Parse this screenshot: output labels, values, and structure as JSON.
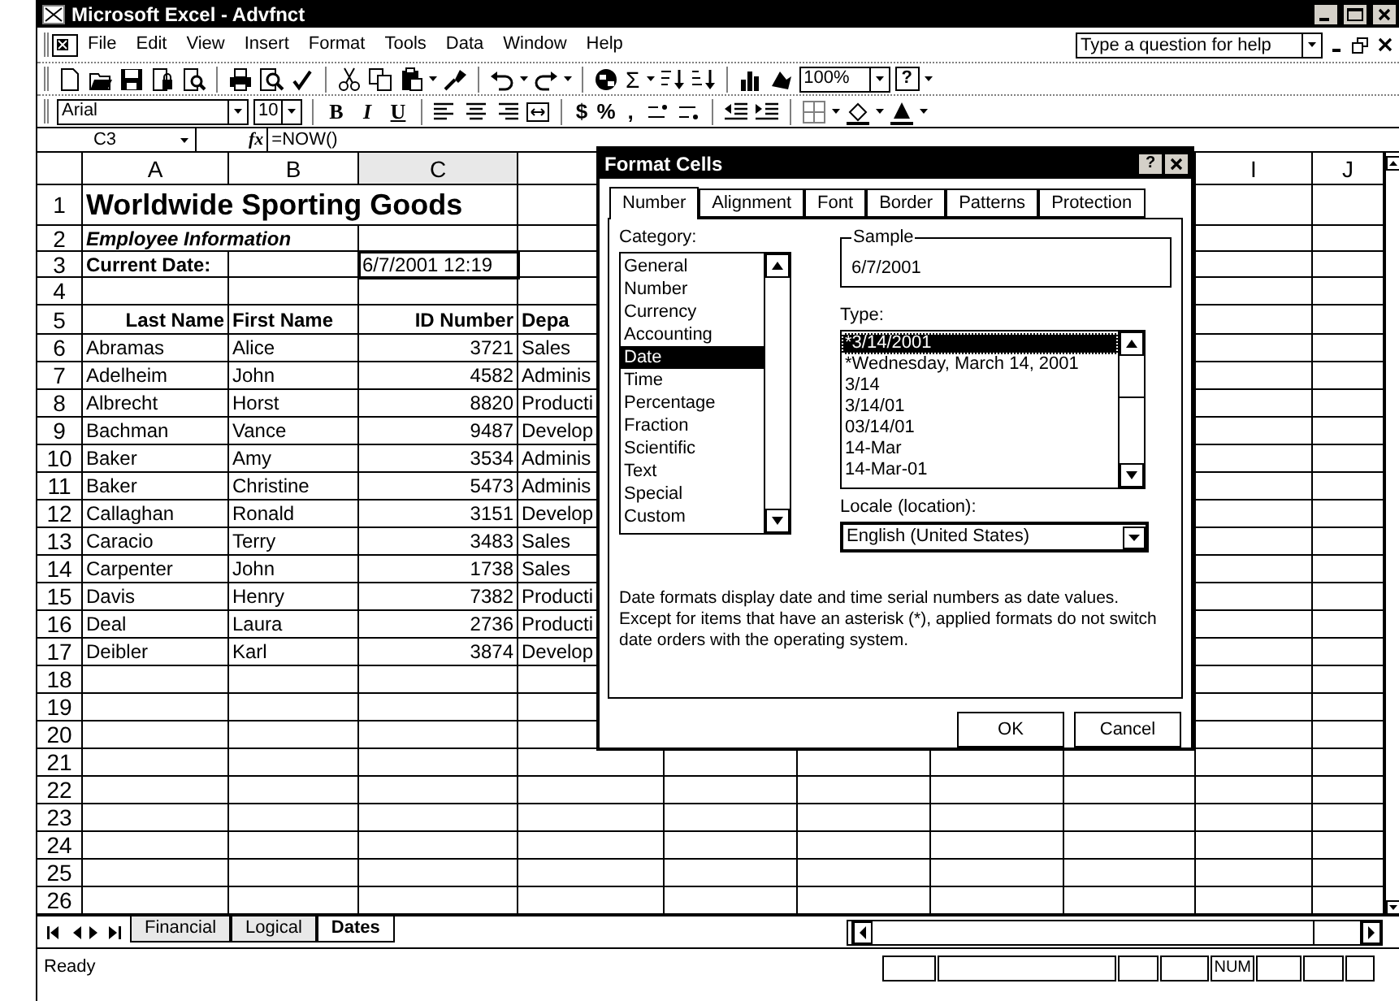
{
  "window": {
    "title": "Microsoft Excel - Advfnct"
  },
  "menu": [
    "File",
    "Edit",
    "View",
    "Insert",
    "Format",
    "Tools",
    "Data",
    "Window",
    "Help"
  ],
  "help_box": {
    "placeholder": "Type a question for help"
  },
  "standard_toolbar": {
    "autosum": "Σ",
    "zoom": "100%",
    "help": "?"
  },
  "formatting_toolbar": {
    "font": "Arial",
    "size": "10",
    "style_buttons": [
      "B",
      "I",
      "U"
    ],
    "number_buttons": [
      "$",
      "%",
      ","
    ]
  },
  "formula_bar": {
    "name_box": "C3",
    "fx": "fx",
    "formula": "=NOW()"
  },
  "sheet": {
    "columns": [
      {
        "label": "A",
        "selected": false
      },
      {
        "label": "B",
        "selected": false
      },
      {
        "label": "C",
        "selected": true
      },
      {
        "selected": false
      },
      {
        "label": "I",
        "selected": false
      },
      {
        "label": "J",
        "selected": false
      }
    ],
    "rows": [
      {
        "number": "1",
        "kind": "title",
        "selected": false,
        "cells": {
          "a": "Worldwide Sporting Goods"
        }
      },
      {
        "number": "2",
        "kind": "subtitle",
        "selected": false,
        "cells": {
          "a": "Employee Information"
        }
      },
      {
        "number": "3",
        "kind": "label",
        "selected": true,
        "cells": {
          "a": "Current Date:",
          "c": "6/7/2001 12:19"
        }
      },
      {
        "number": "4",
        "kind": "blank",
        "selected": false
      },
      {
        "number": "5",
        "kind": "header",
        "selected": false,
        "cells": {
          "a": "Last Name",
          "b": "First Name",
          "c": "ID Number",
          "d": "Depa"
        }
      },
      {
        "number": "6",
        "kind": "data",
        "selected": false,
        "cells": {
          "a": "Abramas",
          "b": "Alice",
          "c": "3721",
          "d": "Sales"
        }
      },
      {
        "number": "7",
        "kind": "data",
        "selected": false,
        "cells": {
          "a": "Adelheim",
          "b": "John",
          "c": "4582",
          "d": "Adminis"
        }
      },
      {
        "number": "8",
        "kind": "data",
        "selected": false,
        "cells": {
          "a": "Albrecht",
          "b": "Horst",
          "c": "8820",
          "d": "Producti"
        }
      },
      {
        "number": "9",
        "kind": "data",
        "selected": false,
        "cells": {
          "a": "Bachman",
          "b": "Vance",
          "c": "9487",
          "d": "Develop"
        }
      },
      {
        "number": "10",
        "kind": "data",
        "selected": false,
        "cells": {
          "a": "Baker",
          "b": "Amy",
          "c": "3534",
          "d": "Adminis"
        }
      },
      {
        "number": "11",
        "kind": "data",
        "selected": false,
        "cells": {
          "a": "Baker",
          "b": "Christine",
          "c": "5473",
          "d": "Adminis"
        }
      },
      {
        "number": "12",
        "kind": "data",
        "selected": false,
        "cells": {
          "a": "Callaghan",
          "b": "Ronald",
          "c": "3151",
          "d": "Develop"
        }
      },
      {
        "number": "13",
        "kind": "data",
        "selected": false,
        "cells": {
          "a": "Caracio",
          "b": "Terry",
          "c": "3483",
          "d": "Sales"
        }
      },
      {
        "number": "14",
        "kind": "data",
        "selected": false,
        "cells": {
          "a": "Carpenter",
          "b": "John",
          "c": "1738",
          "d": "Sales"
        }
      },
      {
        "number": "15",
        "kind": "data",
        "selected": false,
        "cells": {
          "a": "Davis",
          "b": "Henry",
          "c": "7382",
          "d": "Producti"
        }
      },
      {
        "number": "16",
        "kind": "data",
        "selected": false,
        "cells": {
          "a": "Deal",
          "b": "Laura",
          "c": "2736",
          "d": "Producti"
        }
      },
      {
        "number": "17",
        "kind": "data",
        "selected": false,
        "cells": {
          "a": "Deibler",
          "b": "Karl",
          "c": "3874",
          "d": "Develop"
        }
      },
      {
        "number": "18",
        "kind": "blank",
        "selected": false
      },
      {
        "number": "19",
        "kind": "blank",
        "selected": false
      },
      {
        "number": "20",
        "kind": "blank",
        "selected": false
      },
      {
        "number": "21",
        "kind": "blank",
        "selected": false
      },
      {
        "number": "22",
        "kind": "blank",
        "selected": false
      },
      {
        "number": "23",
        "kind": "blank",
        "selected": false
      },
      {
        "number": "24",
        "kind": "blank",
        "selected": false
      },
      {
        "number": "25",
        "kind": "blank",
        "selected": false
      },
      {
        "number": "26",
        "kind": "blank",
        "selected": false
      }
    ]
  },
  "sheet_tabs": [
    {
      "label": "Financial",
      "selected": false
    },
    {
      "label": "Logical",
      "selected": false
    },
    {
      "label": "Dates",
      "selected": true
    }
  ],
  "status_bar": {
    "text": "Ready",
    "indicators": [
      "NUM"
    ]
  },
  "dialog": {
    "title": "Format Cells",
    "help": "?",
    "tabs": [
      {
        "label": "Number",
        "selected": true
      },
      {
        "label": "Alignment",
        "selected": false
      },
      {
        "label": "Font",
        "selected": false
      },
      {
        "label": "Border",
        "selected": false
      },
      {
        "label": "Patterns",
        "selected": false
      },
      {
        "label": "Protection",
        "selected": false
      }
    ],
    "category": {
      "label": "Category:",
      "items": [
        {
          "label": "General",
          "selected": false
        },
        {
          "label": "Number",
          "selected": false
        },
        {
          "label": "Currency",
          "selected": false
        },
        {
          "label": "Accounting",
          "selected": false
        },
        {
          "label": "Date",
          "selected": true
        },
        {
          "label": "Time",
          "selected": false
        },
        {
          "label": "Percentage",
          "selected": false
        },
        {
          "label": "Fraction",
          "selected": false
        },
        {
          "label": "Scientific",
          "selected": false
        },
        {
          "label": "Text",
          "selected": false
        },
        {
          "label": "Special",
          "selected": false
        },
        {
          "label": "Custom",
          "selected": false
        }
      ]
    },
    "sample": {
      "label": "Sample",
      "value": "6/7/2001"
    },
    "type": {
      "label": "Type:",
      "items": [
        {
          "label": "*3/14/2001",
          "selected": true
        },
        {
          "label": "*Wednesday, March 14, 2001",
          "selected": false
        },
        {
          "label": "3/14",
          "selected": false
        },
        {
          "label": "3/14/01",
          "selected": false
        },
        {
          "label": "03/14/01",
          "selected": false
        },
        {
          "label": "14-Mar",
          "selected": false
        },
        {
          "label": "14-Mar-01",
          "selected": false
        }
      ]
    },
    "locale": {
      "label": "Locale (location):",
      "value": "English (United States)"
    },
    "description": "Date formats display date and time serial numbers as date values. Except for items that have an asterisk (*), applied formats do not switch date orders with the operating system.",
    "buttons": [
      "OK",
      "Cancel"
    ]
  }
}
